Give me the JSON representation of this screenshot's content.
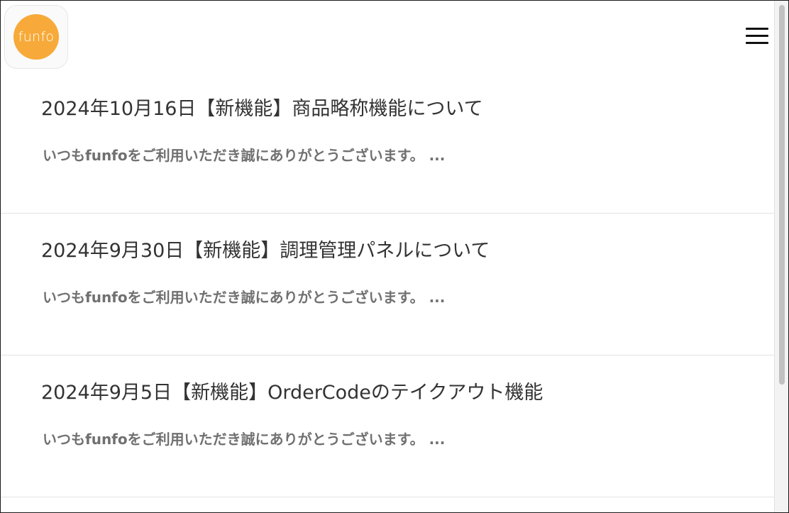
{
  "header": {
    "logo_text": "funfo",
    "menu_icon": "hamburger-menu-icon"
  },
  "colors": {
    "logo_orange": "#f7aa39",
    "title_text": "#333333",
    "excerpt_text": "#707070"
  },
  "posts": [
    {
      "title": "2024年10月16日【新機能】商品略称機能について",
      "excerpt": "いつもfunfoをご利用いただき誠にありがとうございます。 ..."
    },
    {
      "title": "2024年9月30日【新機能】調理管理パネルについて",
      "excerpt": "いつもfunfoをご利用いただき誠にありがとうございます。 ..."
    },
    {
      "title": "2024年9月5日【新機能】OrderCodeのテイクアウト機能",
      "excerpt": "いつもfunfoをご利用いただき誠にありがとうございます。 ..."
    }
  ]
}
